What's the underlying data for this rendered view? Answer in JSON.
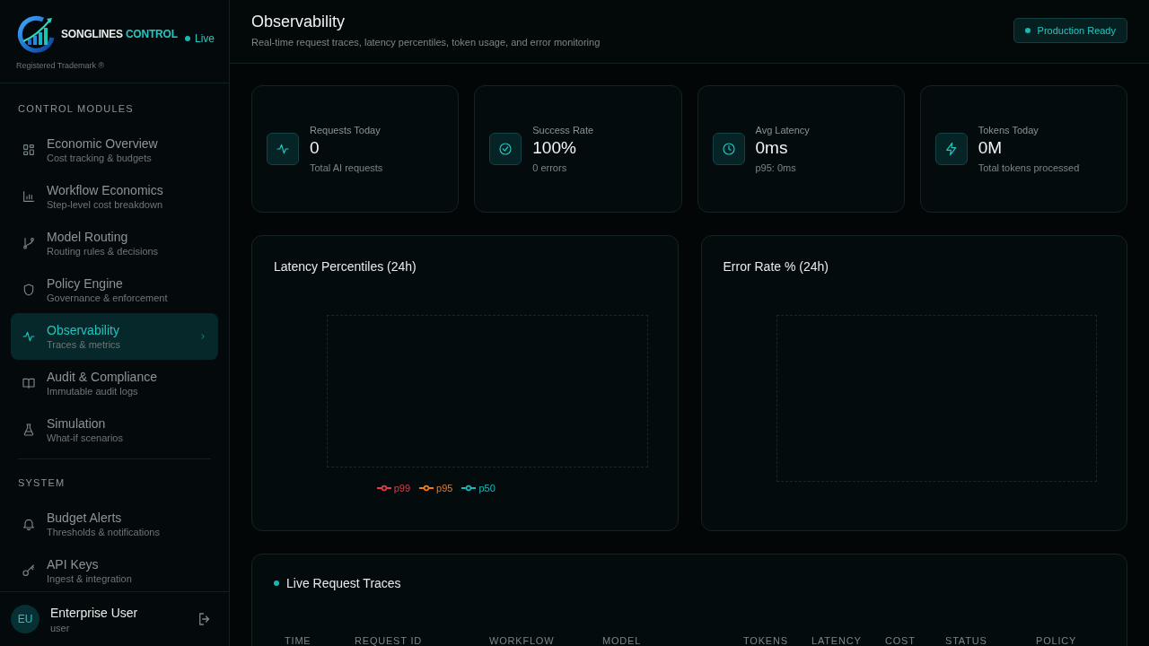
{
  "sidebar": {
    "brand": {
      "name": "SONGLINES",
      "accent": "CONTROL",
      "tagline": "Registered Trademark ®",
      "status": "Live"
    },
    "sections": [
      {
        "title": "CONTROL MODULES",
        "items": [
          {
            "kind": "grid",
            "label": "Economic Overview",
            "sub": "Cost tracking & budgets",
            "selected": false
          },
          {
            "kind": "bars",
            "label": "Workflow Economics",
            "sub": "Step-level cost breakdown",
            "selected": false
          },
          {
            "kind": "branch",
            "label": "Model Routing",
            "sub": "Routing rules & decisions",
            "selected": false
          },
          {
            "kind": "shield",
            "label": "Policy Engine",
            "sub": "Governance & enforcement",
            "selected": false
          },
          {
            "kind": "pulse",
            "label": "Observability",
            "sub": "Traces & metrics",
            "selected": true
          },
          {
            "kind": "book",
            "label": "Audit & Compliance",
            "sub": "Immutable audit logs",
            "selected": false
          },
          {
            "kind": "flask",
            "label": "Simulation",
            "sub": "What-if scenarios",
            "selected": false
          }
        ]
      },
      {
        "title": "SYSTEM",
        "items": [
          {
            "kind": "bell",
            "label": "Budget Alerts",
            "sub": "Thresholds & notifications",
            "selected": false
          },
          {
            "kind": "key",
            "label": "API Keys",
            "sub": "Ingest & integration",
            "selected": false
          }
        ]
      }
    ],
    "user": {
      "initials": "EU",
      "name": "Enterprise User",
      "role": "user"
    }
  },
  "header": {
    "title": "Observability",
    "subtitle": "Real-time request traces, latency percentiles, token usage, and error monitoring",
    "badge": "Production Ready"
  },
  "stats": [
    {
      "kind": "pulse",
      "label": "Requests Today",
      "value": "0",
      "note": "Total AI requests"
    },
    {
      "kind": "check",
      "label": "Success Rate",
      "value": "100%",
      "note": "0 errors"
    },
    {
      "kind": "clock",
      "label": "Avg Latency",
      "value": "0ms",
      "note": "p95: 0ms"
    },
    {
      "kind": "bolt",
      "label": "Tokens Today",
      "value": "0M",
      "note": "Total tokens processed"
    }
  ],
  "charts": [
    {
      "title": "Latency Percentiles (24h)",
      "legend": [
        {
          "label": "p99",
          "color": "#e23b4a"
        },
        {
          "label": "p95",
          "color": "#f07a1a"
        },
        {
          "label": "p50",
          "color": "#17b8b8"
        }
      ]
    },
    {
      "title": "Error Rate % (24h)"
    }
  ],
  "traces": {
    "title": "Live Request Traces",
    "columns": [
      "TIME",
      "REQUEST ID",
      "WORKFLOW",
      "MODEL",
      "TOKENS",
      "LATENCY",
      "COST",
      "STATUS",
      "POLICY"
    ]
  }
}
